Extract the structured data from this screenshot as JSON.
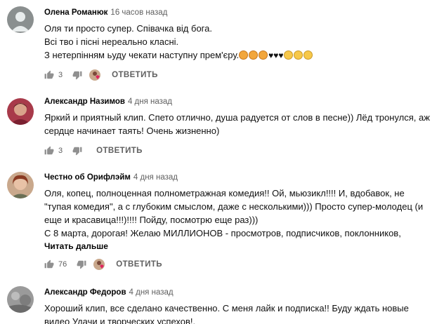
{
  "comments": [
    {
      "author": "Олена Романюк",
      "time": "16 часов назад",
      "lines": [
        "Оля ти просто супер. Співачка від бога.",
        "Всі тво і пісні нереально класні.",
        "З нетерпінням ьуду чекати наступну прем'єру."
      ],
      "likes": "3",
      "reply_label": "ОТВЕТИТЬ",
      "avatar_color": "#8a8f8f"
    },
    {
      "author": "Александр Назимов",
      "time": "4 дня назад",
      "lines": [
        "Яркий и приятный клип. Спето отлично, душа радуется от слов в песне)) Лёд тронулся, аж",
        "сердце начинает таять! Очень жизненно)"
      ],
      "likes": "3",
      "reply_label": "ОТВЕТИТЬ",
      "avatar_color": "#a83a4a"
    },
    {
      "author": "Честно об Орифлэйм",
      "time": "4 дня назад",
      "lines": [
        "Оля, копец, полноценная полнометражная комедия!! Ой,  мьюзикл!!!! И, вдобавок, не",
        "\"тупая комедия\", а с глубоким смыслом, даже с несколькими))) Просто супер-молодец (и",
        "еще и красавица!!!)!!!! Пойду, посмотрю еще раз)))",
        "С 8 марта, дорогая! Желаю МИЛЛИОНОВ - просмотров, подписчиков, поклонников,"
      ],
      "read_more": "Читать дальше",
      "likes": "76",
      "reply_label": "ОТВЕТИТЬ",
      "avatar_color": "#c9a88c"
    },
    {
      "author": "Александр Федоров",
      "time": "4 дня назад",
      "lines": [
        "Хороший клип, все сделано качественно.  С меня лайк и подписка!! Буду ждать новые",
        "видео Удачи и творческих успехов!."
      ],
      "avatar_color": "#9a9a9a"
    }
  ],
  "icons": {
    "like": "thumbs-up-icon",
    "dislike": "thumbs-down-icon",
    "creator_heart": "creator-heart-avatar"
  },
  "colors": {
    "text": "#030303",
    "secondary": "#606060"
  }
}
